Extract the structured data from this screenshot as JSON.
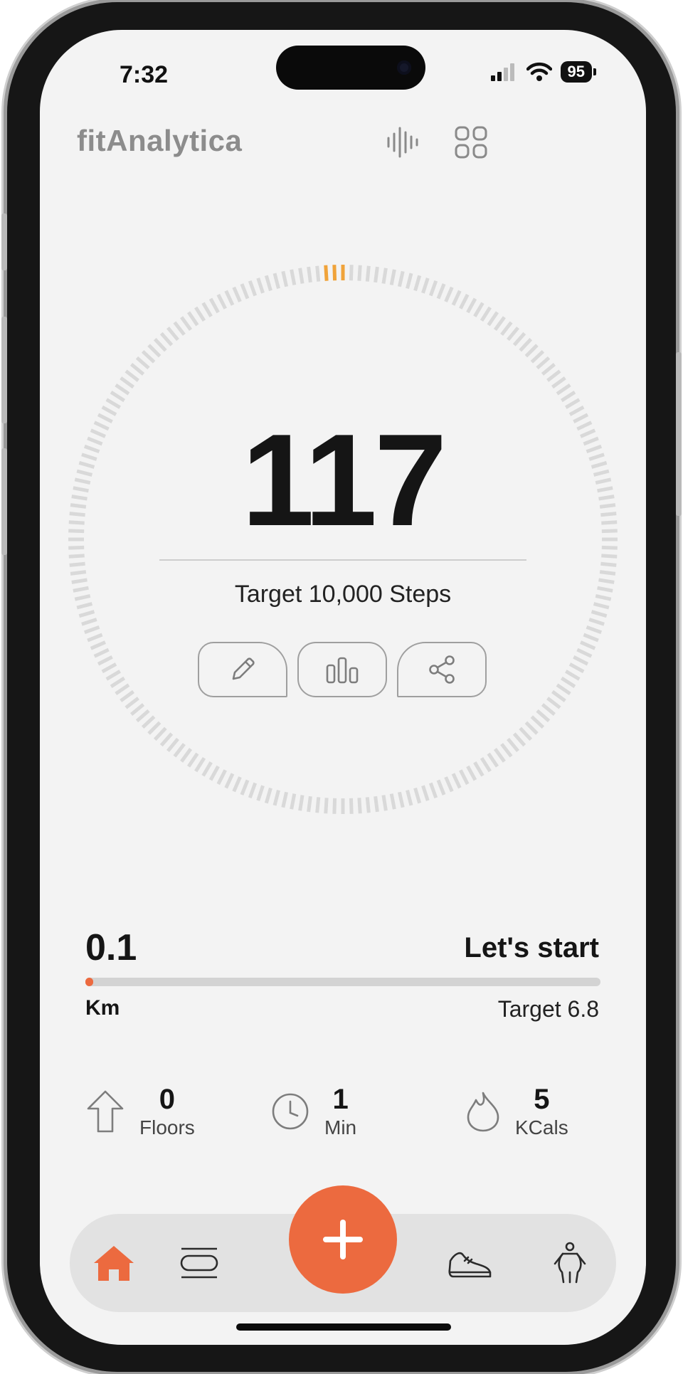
{
  "status_bar": {
    "time": "7:32",
    "battery": "95"
  },
  "header": {
    "app_title": "fitAnalytica",
    "icons": [
      "waveform-icon",
      "grid-icon"
    ]
  },
  "steps": {
    "value": "117",
    "target_label": "Target 10,000 Steps",
    "progress": 0.0117,
    "actions": [
      "pencil-icon",
      "bar-chart-icon",
      "share-icon"
    ]
  },
  "distance": {
    "value": "0.1",
    "status": "Let's start",
    "unit": "Km",
    "target_label": "Target 6.8",
    "progress": 0.015
  },
  "stats": [
    {
      "icon": "arrow-up-icon",
      "value": "0",
      "label": "Floors"
    },
    {
      "icon": "clock-icon",
      "value": "1",
      "label": "Min"
    },
    {
      "icon": "flame-icon",
      "value": "5",
      "label": "KCals"
    }
  ],
  "tabbar": {
    "items": [
      "home-icon",
      "list-icon",
      "add-icon",
      "sneaker-icon",
      "body-icon"
    ],
    "active": "home-icon"
  },
  "colors": {
    "accent": "#EC6A3F",
    "ring_progress": "#F0A33A",
    "ring_track": "#D9D9D9",
    "text": "#151515"
  }
}
